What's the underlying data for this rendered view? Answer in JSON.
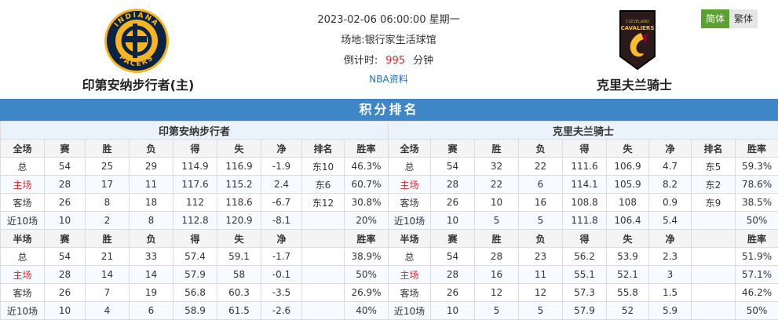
{
  "match": {
    "datetime": "2023-02-06 06:00:00 星期一",
    "venue": "场地:银行家生活球馆",
    "countdown_label": "倒计时:",
    "countdown_value": "995",
    "countdown_unit": "分钟",
    "link": "NBA资料"
  },
  "lang": {
    "simplified": "简体",
    "traditional": "繁体"
  },
  "home": {
    "name": "印第安纳步行者(主)",
    "logo_text_top": "INDIANA",
    "logo_text_bottom": "PACERS",
    "table_title": "印第安纳步行者"
  },
  "away": {
    "name": "克里夫兰骑士",
    "logo_text_top": "CLEVELAND",
    "logo_text_mid": "CAVALIERS",
    "table_title": "克里夫兰骑士"
  },
  "banner": "积分排名",
  "colors": {
    "banner": "#3f86c6",
    "home_accent": "#d9262e",
    "lang_active": "#5aa131"
  },
  "headers_full": [
    "全场",
    "赛",
    "胜",
    "负",
    "得",
    "失",
    "净",
    "排名",
    "胜率"
  ],
  "headers_half": [
    "半场",
    "赛",
    "胜",
    "负",
    "得",
    "失",
    "净",
    "",
    "胜率"
  ],
  "home_full": [
    [
      "总",
      "54",
      "25",
      "29",
      "114.9",
      "116.9",
      "-1.9",
      "东10",
      "46.3%"
    ],
    [
      "主场",
      "28",
      "17",
      "11",
      "117.6",
      "115.2",
      "2.4",
      "东6",
      "60.7%"
    ],
    [
      "客场",
      "26",
      "8",
      "18",
      "112",
      "118.6",
      "-6.7",
      "东12",
      "30.8%"
    ],
    [
      "近10场",
      "10",
      "2",
      "8",
      "112.8",
      "120.9",
      "-8.1",
      "",
      "20%"
    ]
  ],
  "home_half": [
    [
      "总",
      "54",
      "21",
      "33",
      "57.4",
      "59.1",
      "-1.7",
      "",
      "38.9%"
    ],
    [
      "主场",
      "28",
      "14",
      "14",
      "57.9",
      "58",
      "-0.1",
      "",
      "50%"
    ],
    [
      "客场",
      "26",
      "7",
      "19",
      "56.8",
      "60.3",
      "-3.5",
      "",
      "26.9%"
    ],
    [
      "近10场",
      "10",
      "4",
      "6",
      "58.9",
      "61.5",
      "-2.6",
      "",
      "40%"
    ]
  ],
  "away_full": [
    [
      "总",
      "54",
      "32",
      "22",
      "111.6",
      "106.9",
      "4.7",
      "东5",
      "59.3%"
    ],
    [
      "主场",
      "28",
      "22",
      "6",
      "114.1",
      "105.9",
      "8.2",
      "东2",
      "78.6%"
    ],
    [
      "客场",
      "26",
      "10",
      "16",
      "108.8",
      "108",
      "0.9",
      "东9",
      "38.5%"
    ],
    [
      "近10场",
      "10",
      "5",
      "5",
      "111.8",
      "106.4",
      "5.4",
      "",
      "50%"
    ]
  ],
  "away_half": [
    [
      "总",
      "54",
      "28",
      "23",
      "56.2",
      "53.9",
      "2.3",
      "",
      "51.9%"
    ],
    [
      "主场",
      "28",
      "16",
      "11",
      "55.1",
      "52.1",
      "3",
      "",
      "57.1%"
    ],
    [
      "客场",
      "26",
      "12",
      "12",
      "57.3",
      "55.8",
      "1.5",
      "",
      "46.2%"
    ],
    [
      "近10场",
      "10",
      "5",
      "5",
      "57.9",
      "52",
      "5.9",
      "",
      "50%"
    ]
  ]
}
